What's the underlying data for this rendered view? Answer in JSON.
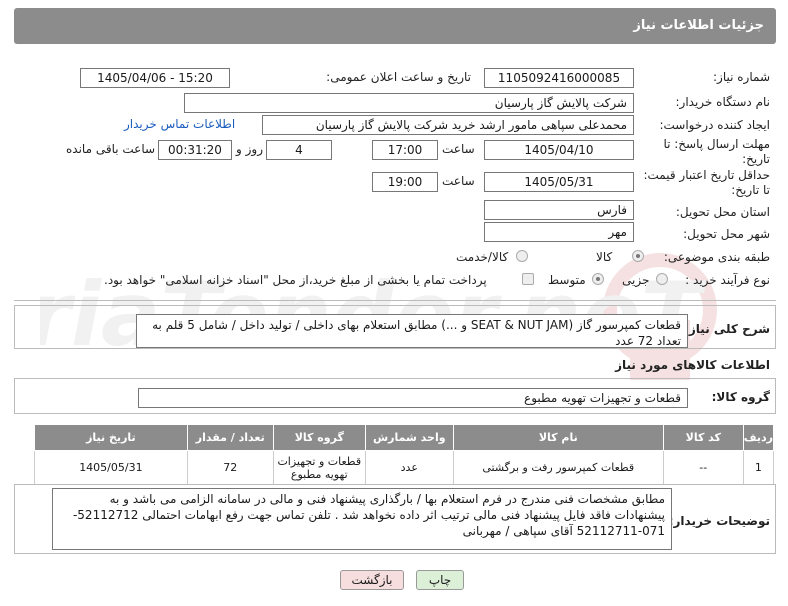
{
  "header": {
    "title": "جزئیات اطلاعات نیاز"
  },
  "form": {
    "need_number_label": "شماره نیاز:",
    "need_number": "1105092416000085",
    "announce_label": "تاریخ و ساعت اعلان عمومی:",
    "announce_value": "1405/04/06 - 15:20",
    "buyer_label": "نام دستگاه خریدار:",
    "buyer_value": "شرکت پالایش گاز پارسیان",
    "creator_label": "ایجاد کننده درخواست:",
    "creator_value": "محمدعلی سپاهی مامور ارشد خرید شرکت پالایش گاز پارسیان",
    "contact_link": "اطلاعات تماس خریدار",
    "deadline_label_1": "مهلت ارسال پاسخ: تا",
    "deadline_label_2": "تاریخ:",
    "deadline_date": "1405/04/10",
    "time_label": "ساعت",
    "deadline_time": "17:00",
    "days_value": "4",
    "days_label": "روز و",
    "remaining_value": "00:31:20",
    "remaining_label": "ساعت باقی مانده",
    "price_label_1": "حداقل تاریخ اعتبار قیمت:",
    "price_label_2": "تا تاریخ:",
    "price_date": "1405/05/31",
    "price_time": "19:00",
    "province_label": "استان محل تحویل:",
    "province_value": "فارس",
    "city_label": "شهر محل تحویل:",
    "city_value": "مهر",
    "category_label": "طبقه بندی موضوعی:",
    "category_goods": "کالا",
    "category_service": "کالا/خدمت",
    "process_label": "نوع فرآیند خرید :",
    "process_minor": "جزیی",
    "process_medium": "متوسط",
    "payment_note": "پرداخت تمام یا بخشی از مبلغ خرید،از محل \"اسناد خزانه اسلامی\" خواهد بود."
  },
  "summary": {
    "label": "شرح کلی نیاز:",
    "text": "قطعات کمپرسور گاز (SEAT & NUT JAM و ...) مطابق استعلام بهای داخلی / تولید داخل / شامل 5 قلم به تعداد  72 عدد"
  },
  "goods_info": {
    "title": "اطلاعات کالاهای مورد نیاز",
    "group_label": "گروه کالا:",
    "group_value": "قطعات و تجهیزات تهویه مطبوع"
  },
  "table": {
    "headers": [
      "ردیف",
      "کد کالا",
      "نام کالا",
      "واحد شمارش",
      "گروه کالا",
      "تعداد / مقدار",
      "تاریخ نیاز"
    ],
    "rows": [
      [
        "1",
        "--",
        "قطعات کمپرسور رفت و برگشتی",
        "عدد",
        "قطعات و تجهیزات تهویه مطبوع",
        "72",
        "1405/05/31"
      ]
    ]
  },
  "buyer_notes": {
    "label": "توضیحات خریدار:",
    "text": "مطابق مشخصات فنی مندرج در فرم استعلام بها / بارگذاری پیشنهاد فنی و مالی در سامانه الزامی می باشد و به پیشنهادات فاقد فایل پیشنهاد فنی مالی ترتیب اثر داده نخواهد شد . تلفن تماس جهت رفع ابهامات احتمالی 52112712-071-52112711 آقای سپاهی / مهربانی"
  },
  "buttons": {
    "print": "چاپ",
    "back": "بازگشت"
  },
  "watermark_text": "AriaTender.neT"
}
